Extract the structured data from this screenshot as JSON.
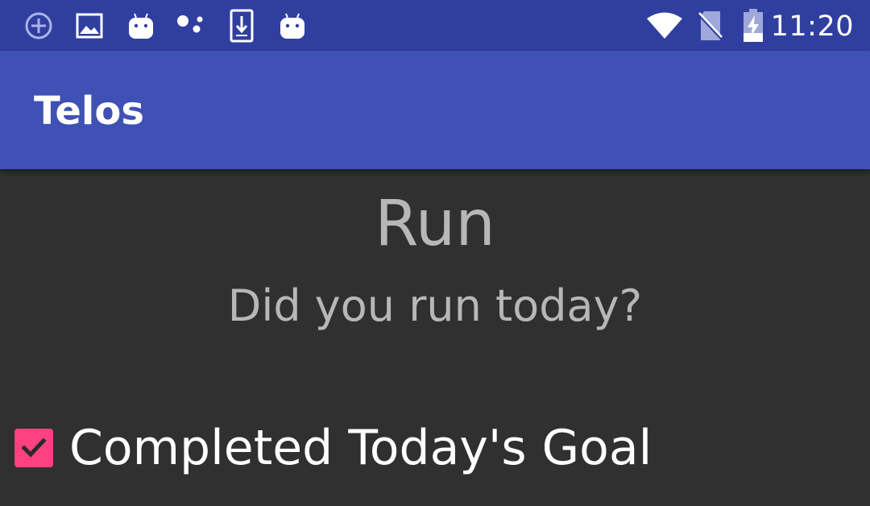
{
  "status_bar": {
    "time": "11:20",
    "notification_icons": [
      "add-circle-icon",
      "image-icon",
      "android-icon",
      "assistant-dots-icon",
      "download-icon",
      "android-icon"
    ],
    "system_icons": [
      "wifi-icon",
      "no-sim-icon",
      "battery-charging-icon"
    ]
  },
  "app_bar": {
    "title": "Telos"
  },
  "goal": {
    "title": "Run",
    "question": "Did you run today?",
    "checkbox_label": "Completed Today's Goal",
    "checked": true
  },
  "colors": {
    "status_bar": "#303f9f",
    "app_bar": "#3f51b5",
    "background": "#303030",
    "accent": "#ff4081",
    "secondary_text": "#b7b7b7"
  }
}
